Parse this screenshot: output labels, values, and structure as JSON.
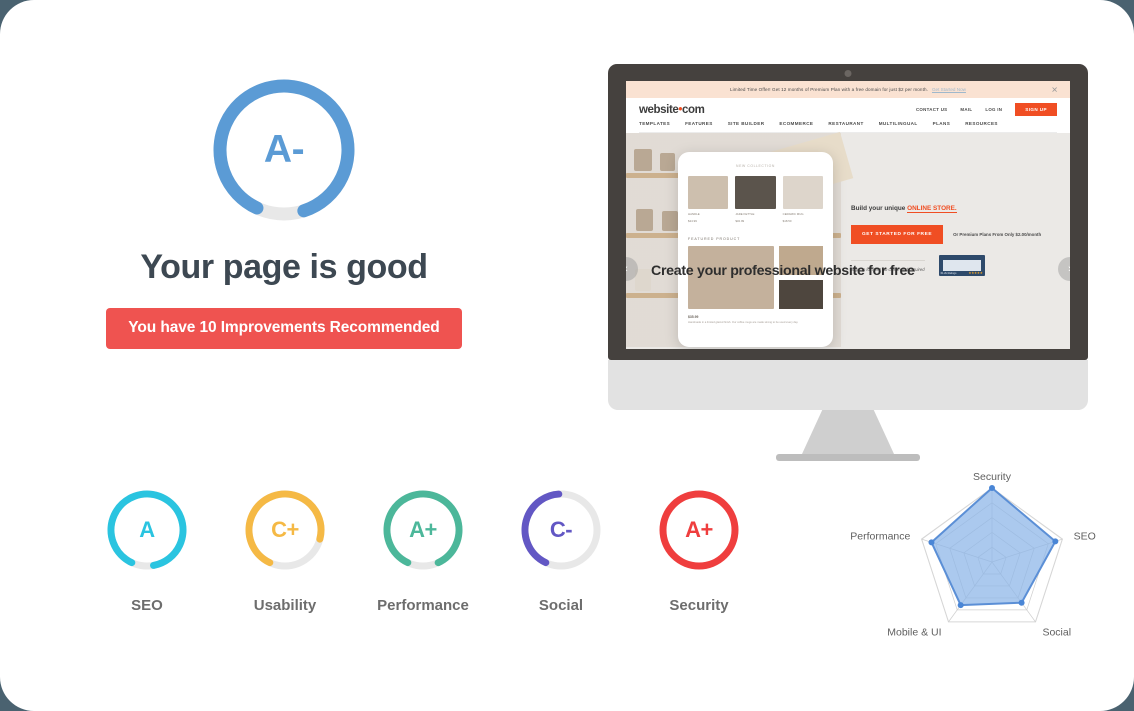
{
  "theme": {
    "page_background": "#4a6270",
    "card_background": "#ffffff",
    "accent_blue": "#5b9bd5",
    "accent_red": "#ef5350",
    "track_gray": "#e8e8e8"
  },
  "main_score": {
    "grade": "A-",
    "grade_color": "#5b9bd5",
    "percent": 88,
    "headline": "Your page is good",
    "improvements_button": "You have 10 Improvements Recommended",
    "improvements_count": 10
  },
  "categories": [
    {
      "label": "SEO",
      "grade": "A",
      "percent": 90,
      "color": "#2ac4e0"
    },
    {
      "label": "Usability",
      "grade": "C+",
      "percent": 72,
      "color": "#f5b945"
    },
    {
      "label": "Performance",
      "grade": "A+",
      "percent": 86,
      "color": "#4cb79a"
    },
    {
      "label": "Social",
      "grade": "C-",
      "percent": 42,
      "color": "#6257c4"
    },
    {
      "label": "Security",
      "grade": "A+",
      "percent": 100,
      "color": "#ef3e3e"
    }
  ],
  "chart_data": {
    "type": "radar",
    "title": "",
    "categories": [
      "Security",
      "SEO",
      "Social",
      "Mobile & UI",
      "Performance"
    ],
    "values": [
      100,
      90,
      68,
      72,
      86
    ],
    "ylim": [
      0,
      100
    ],
    "rings": 5,
    "grid": true,
    "legend": "none",
    "fill_color": "#8ab4e8",
    "line_color": "#5b8fd6",
    "point_color": "#4a86d6"
  },
  "monitor": {
    "site": {
      "promo_text": "Limited Time Offer! Get 12 months of Premium Plan with a free domain for just $2 per month.",
      "promo_link": "Get Started Now",
      "promo_close_icon": "close-icon",
      "logo": "website",
      "logo_dot": "•",
      "logo_suffix": "com",
      "top_links": [
        "CONTACT US",
        "MAIL",
        "LOG IN"
      ],
      "signup_button": "SIGN UP",
      "nav_links": [
        "TEMPLATES",
        "FEATURES",
        "SITE BUILDER",
        "ECOMMERCE",
        "RESTAURANT",
        "MULTILINGUAL",
        "PLANS",
        "RESOURCES"
      ],
      "hero_title": "Create your professional website for free",
      "hero_kicker_prefix": "Build your unique ",
      "hero_kicker_highlight": "ONLINE STORE.",
      "cta_button": "GET STARTED FOR FREE",
      "cta_note": "Or Premium Plans From Only $2.00/month",
      "fineprint": "Sign up for free! No credit card required",
      "award_rating_count": "61.2k Ratings",
      "award_stars": "★★★★★",
      "arrow_left_icon": "chevron-left-icon",
      "arrow_right_icon": "chevron-right-icon",
      "arrow_left_glyph": "‹",
      "arrow_right_glyph": "›",
      "phone": {
        "eyebrow": "NEW COLLECTION",
        "products": [
          {
            "name": "HANDLE",
            "sub": "$24.99"
          },
          {
            "name": "JADE KETTLE",
            "sub": "$32.99"
          },
          {
            "name": "CERAMIC MUG",
            "sub": "$18.50"
          }
        ],
        "featured_label": "FEATURED PRODUCT",
        "featured_title": "$35.99",
        "featured_desc": "Handmade in a limited glazed finish. Our coffee mugs are made strong to be used every day."
      }
    }
  }
}
